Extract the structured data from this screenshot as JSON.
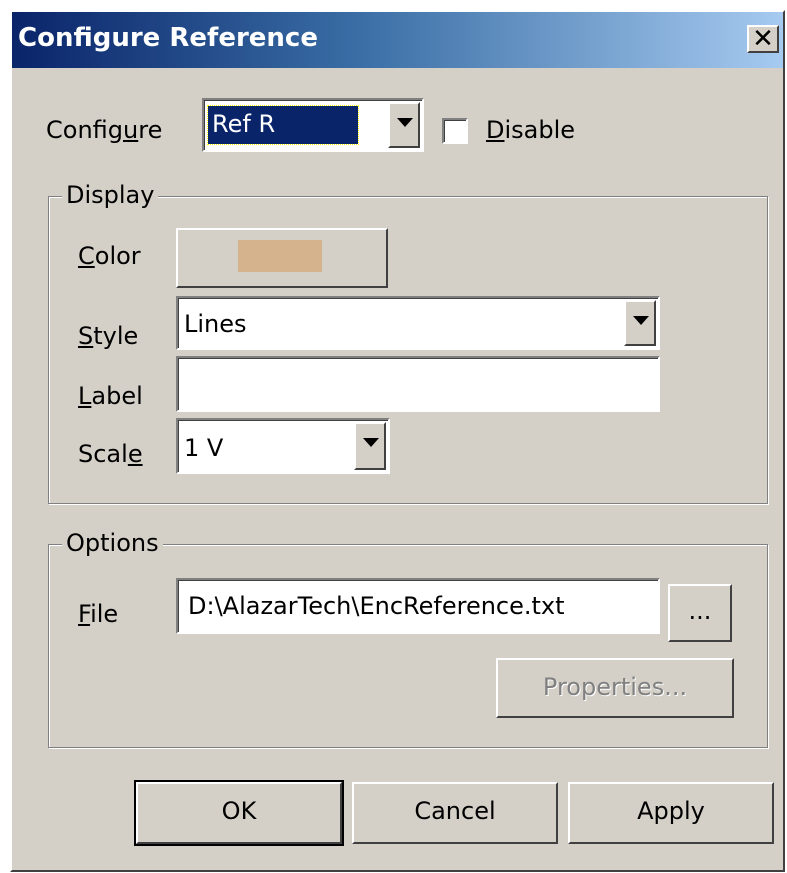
{
  "window": {
    "title": "Configure Reference",
    "close_label": "✕"
  },
  "configure": {
    "label_pre": "Config",
    "label_mnemonic": "u",
    "label_post": "re",
    "selected": "Ref R",
    "disable_mnemonic": "D",
    "disable_rest": "isable",
    "disable_checked": false
  },
  "display_group": {
    "legend": "Display",
    "color_mnemonic": "C",
    "color_rest": "olor",
    "color_swatch": "#d5b48d",
    "style_mnemonic": "S",
    "style_rest": "tyle",
    "style_value": "Lines",
    "label_mnemonic": "L",
    "label_rest": "abel",
    "label_value": "",
    "scale_pre": "Scal",
    "scale_mnemonic": "e",
    "scale_value": "1 V"
  },
  "options_group": {
    "legend": "Options",
    "file_mnemonic": "F",
    "file_rest": "ile",
    "file_value": "D:\\AlazarTech\\EncReference.txt",
    "browse_label": "...",
    "properties_label": "Properties..."
  },
  "buttons": {
    "ok": "OK",
    "cancel": "Cancel",
    "apply": "Apply"
  },
  "colors": {
    "face": "#d4d0c8",
    "title_start": "#0a246a",
    "title_end": "#a6caf0",
    "selection": "#0a246a",
    "disabled_text": "#808080"
  }
}
